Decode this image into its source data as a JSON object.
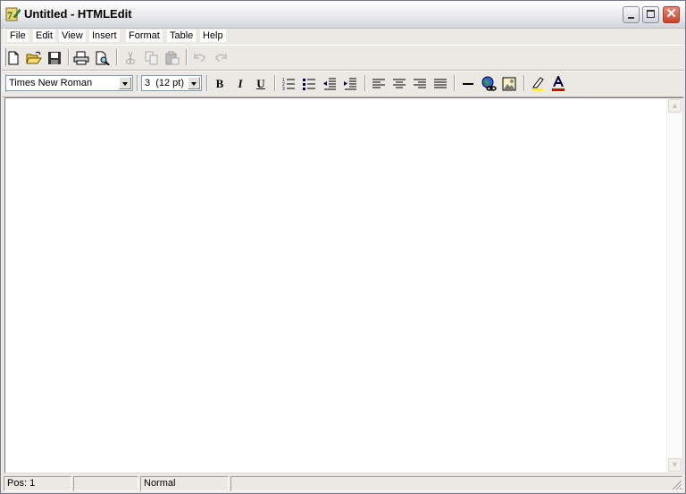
{
  "window": {
    "title": "Untitled - HTMLEdit",
    "app_icon": "htmledit-app-icon",
    "controls": [
      "minimize",
      "maximize",
      "close"
    ]
  },
  "menubar": {
    "items": [
      {
        "label": "File"
      },
      {
        "label": "Edit"
      },
      {
        "label": "View"
      },
      {
        "label": "Insert"
      },
      {
        "label": "Format"
      },
      {
        "label": "Table"
      },
      {
        "label": "Help"
      }
    ]
  },
  "standard_toolbar": {
    "buttons": [
      {
        "name": "new",
        "icon": "new-document-icon",
        "enabled": true
      },
      {
        "name": "open",
        "icon": "open-folder-icon",
        "enabled": true
      },
      {
        "name": "save",
        "icon": "save-disk-icon",
        "enabled": true
      },
      {
        "name": "print",
        "icon": "printer-icon",
        "enabled": true
      },
      {
        "name": "print-preview",
        "icon": "print-preview-icon",
        "enabled": true
      },
      {
        "name": "cut",
        "icon": "scissors-icon",
        "enabled": false
      },
      {
        "name": "copy",
        "icon": "copy-icon",
        "enabled": false
      },
      {
        "name": "paste",
        "icon": "paste-icon",
        "enabled": false
      },
      {
        "name": "undo",
        "icon": "undo-icon",
        "enabled": false
      },
      {
        "name": "redo",
        "icon": "redo-icon",
        "enabled": false
      }
    ]
  },
  "format_toolbar": {
    "font_name": "Times New Roman",
    "font_size": "3  (12 pt)",
    "bold_label": "B",
    "italic_label": "I",
    "underline_label": "U",
    "buttons": [
      {
        "name": "numbered-list",
        "icon": "numbered-list-icon"
      },
      {
        "name": "bulleted-list",
        "icon": "bulleted-list-icon"
      },
      {
        "name": "decrease-indent",
        "icon": "outdent-icon"
      },
      {
        "name": "increase-indent",
        "icon": "indent-icon"
      },
      {
        "name": "align-left",
        "icon": "align-left-icon"
      },
      {
        "name": "align-center",
        "icon": "align-center-icon"
      },
      {
        "name": "align-right",
        "icon": "align-right-icon"
      },
      {
        "name": "justify",
        "icon": "justify-icon"
      },
      {
        "name": "horizontal-rule",
        "icon": "horizontal-rule-icon"
      },
      {
        "name": "insert-link",
        "icon": "hyperlink-globe-icon"
      },
      {
        "name": "insert-image",
        "icon": "image-icon"
      },
      {
        "name": "highlight-color",
        "icon": "highlighter-icon"
      },
      {
        "name": "font-color",
        "icon": "font-color-icon"
      }
    ],
    "colors": {
      "highlight": "#ffff00",
      "font_color": "#e00000"
    }
  },
  "editor": {
    "content": ""
  },
  "statusbar": {
    "position": "Pos: 1",
    "panel2": "",
    "mode": "Normal",
    "panel4": ""
  }
}
